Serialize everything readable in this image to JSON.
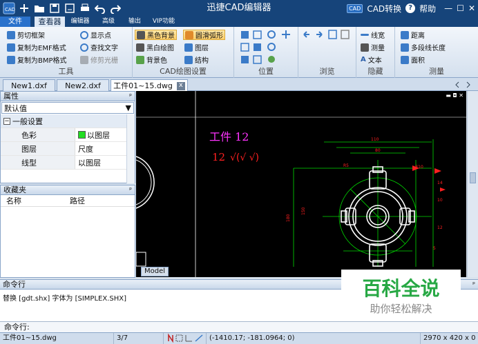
{
  "app": {
    "title": "迅捷CAD编辑器",
    "cad_badge": "CAD",
    "cad_convert": "CAD转换",
    "help": "帮助",
    "help_icon": "?",
    "minimize": "—",
    "maximize": "☐",
    "close": "✕"
  },
  "menu": [
    "文件",
    "查看器",
    "编辑器",
    "高级",
    "输出",
    "VIP功能"
  ],
  "ribbon": {
    "tools": {
      "caption": "工具",
      "items": [
        "剪切框架",
        "复制为EMF格式",
        "复制为BMP格式",
        "显示点",
        "查找文字",
        "修剪光栅"
      ]
    },
    "cad": {
      "caption": "CAD绘图设置",
      "items": [
        "黑色背景",
        "黑白绘图",
        "背景色",
        "圆滑弧形",
        "图层",
        "结构"
      ]
    },
    "position": {
      "caption": "位置"
    },
    "browse": {
      "caption": "浏览"
    },
    "hide": {
      "caption": "隐藏",
      "items": [
        "线宽",
        "测量",
        "文本"
      ]
    },
    "measure": {
      "caption": "测量",
      "items": [
        "距离",
        "多段线长度",
        "面积"
      ]
    }
  },
  "doc_tabs": [
    {
      "label": "New1.dxf"
    },
    {
      "label": "New2.dxf"
    },
    {
      "label": "工件01~15.dwg",
      "close": "x"
    }
  ],
  "properties": {
    "title": "属性",
    "pin": "ᵖ",
    "select": "默认值",
    "group": "一般设置",
    "group_toggle": "−",
    "rows": [
      {
        "key": "色彩",
        "value": "以图层",
        "swatch": "#22dd22"
      },
      {
        "key": "图层",
        "value": "尺度"
      },
      {
        "key": "线型",
        "value": "以图层"
      }
    ]
  },
  "favorites": {
    "title": "收藏夹",
    "pin": "ᵖ",
    "columns": [
      "名称",
      "路径"
    ]
  },
  "canvas": {
    "title_text": "工件 12",
    "num": "12",
    "dim_symbols": "√(√ √)",
    "model_tab": "Model",
    "window_buttons": "▬ ◘ ✕"
  },
  "command": {
    "title": "命令行",
    "pin": "ᵖ",
    "output": "替换 [gdt.shx] 字体为 [SIMPLEX.SHX]",
    "prompt": "命令行:"
  },
  "status": {
    "file": "工件01~15.dwg",
    "page": "3/7",
    "coords": "(-1410.17; -181.0964; 0)",
    "size": "2970 x 420 x 0"
  },
  "watermark": {
    "main": "百科全说",
    "sub": "助你轻松解决"
  },
  "colors": {
    "title_bg": "#16447a",
    "accent": "#2a72cc",
    "canvas_bg": "#000000",
    "dim_green": "#00dd00",
    "dim_red": "#ff2020",
    "text_magenta": "#ff33ff",
    "part_white": "#ffffff"
  }
}
